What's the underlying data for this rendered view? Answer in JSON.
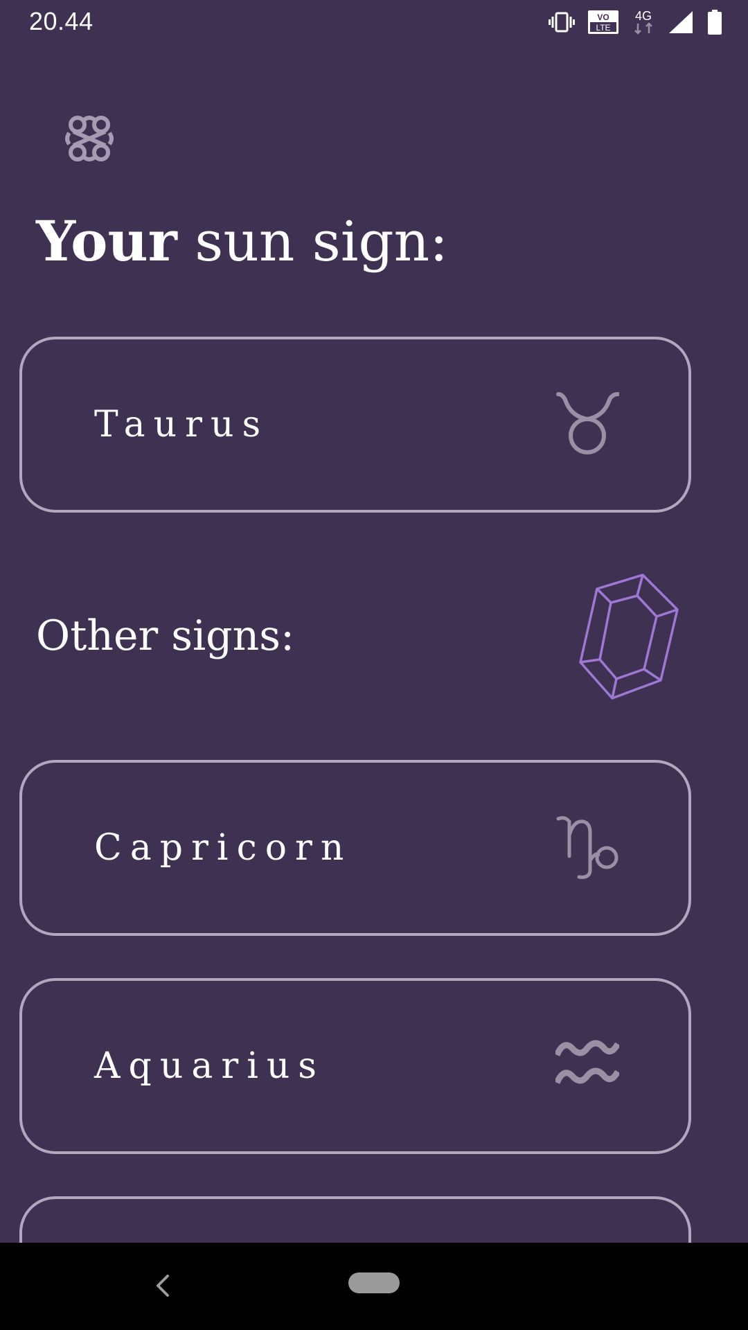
{
  "status_bar": {
    "time": "20.44",
    "volte_label_top": "VO",
    "volte_label_bottom": "LTE",
    "network_label": "4G",
    "icons": [
      "vibrate-icon",
      "volte-icon",
      "network-4g-icon",
      "signal-icon",
      "battery-icon"
    ]
  },
  "header": {
    "logo_icon": "celtic-knot-icon"
  },
  "sun_sign": {
    "heading_bold": "Your",
    "heading_rest": " sun sign:",
    "card": {
      "label": "Taurus",
      "icon": "taurus-glyph-icon"
    }
  },
  "other_signs": {
    "heading": "Other signs:",
    "decoration_icon": "gem-icon",
    "items": [
      {
        "label": "Capricorn",
        "icon": "capricorn-glyph-icon"
      },
      {
        "label": "Aquarius",
        "icon": "aquarius-glyph-icon"
      },
      {
        "label": "",
        "icon": ""
      }
    ]
  },
  "nav_bar": {
    "back_icon": "back-chevron-icon",
    "home_icon": "home-pill-icon"
  },
  "colors": {
    "background": "#3f3152",
    "card_border": "#b3a7bf",
    "glyph": "#9a90a5",
    "gem": "#9f78d6",
    "nav_bar": "#000000"
  }
}
